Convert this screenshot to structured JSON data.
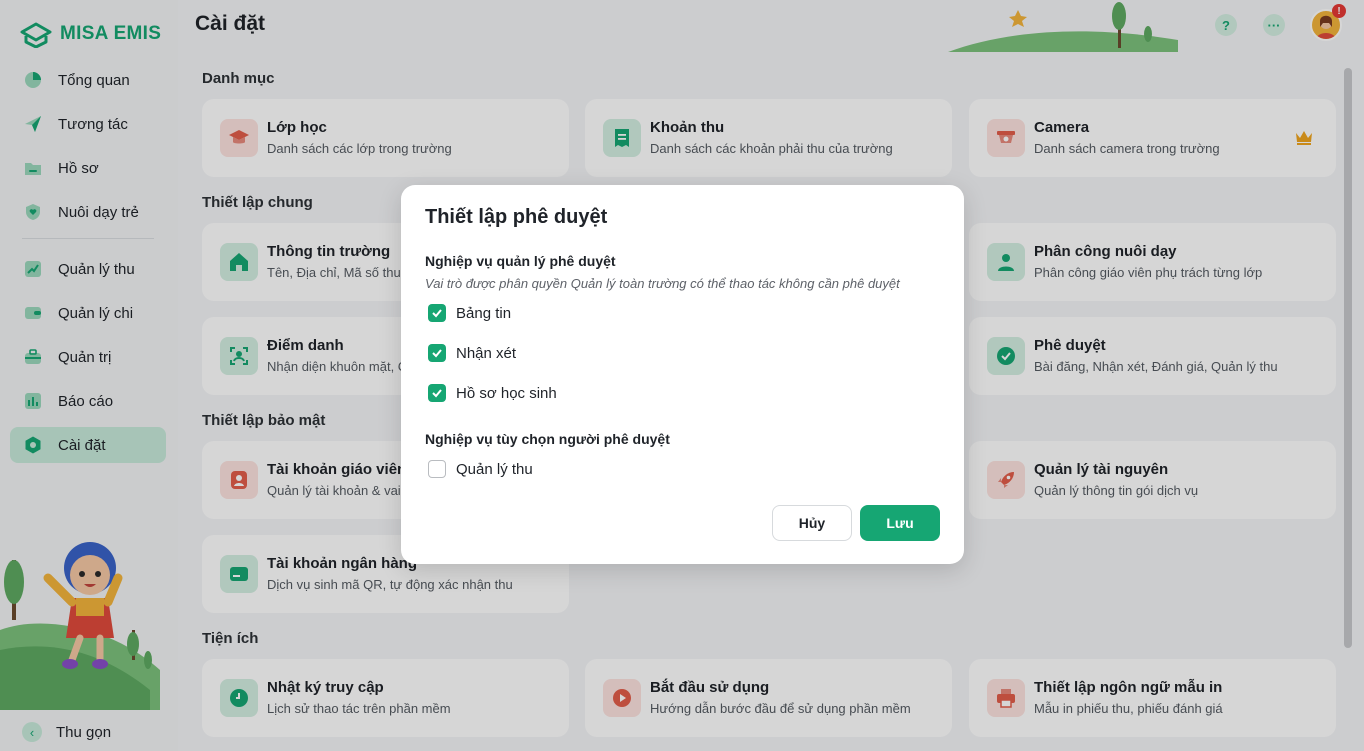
{
  "app": {
    "brand": "MISA EMIS",
    "page_title": "Cài đặt"
  },
  "sidebar": {
    "items": [
      {
        "label": "Tổng quan",
        "icon": "pie-chart-icon"
      },
      {
        "label": "Tương tác",
        "icon": "paper-plane-icon"
      },
      {
        "label": "Hồ sơ",
        "icon": "folder-icon"
      },
      {
        "label": "Nuôi dạy trẻ",
        "icon": "heart-shield-icon"
      },
      {
        "label": "Quản lý thu",
        "icon": "trend-chart-icon"
      },
      {
        "label": "Quản lý chi",
        "icon": "wallet-icon"
      },
      {
        "label": "Quản trị",
        "icon": "briefcase-icon"
      },
      {
        "label": "Báo cáo",
        "icon": "bar-chart-icon"
      },
      {
        "label": "Cài đặt",
        "icon": "gear-icon"
      }
    ],
    "active": "Cài đặt",
    "collapse_label": "Thu gọn"
  },
  "header": {
    "help": "?",
    "more": "···",
    "badge": "!"
  },
  "sections": {
    "danh_muc": "Danh mục",
    "chung": "Thiết lập chung",
    "bao_mat": "Thiết lập bảo mật",
    "tien_ich": "Tiện ích"
  },
  "cards": {
    "lop_hoc": {
      "title": "Lớp học",
      "desc": "Danh sách các lớp trong trường"
    },
    "khoan_thu": {
      "title": "Khoản thu",
      "desc": "Danh sách các khoản phải thu của trường"
    },
    "camera": {
      "title": "Camera",
      "desc": "Danh sách camera trong trường"
    },
    "thong_tin_truong": {
      "title": "Thông tin trường",
      "desc": "Tên, Địa chỉ, Mã số thuế"
    },
    "phan_cong": {
      "title": "Phân công nuôi dạy",
      "desc": "Phân công giáo viên phụ trách từng lớp"
    },
    "diem_danh": {
      "title": "Điểm danh",
      "desc": "Nhận diện khuôn mặt, C"
    },
    "phe_duyet": {
      "title": "Phê duyệt",
      "desc": "Bài đăng, Nhận xét, Đánh giá, Quản lý thu"
    },
    "tk_giao_vien": {
      "title": "Tài khoản giáo viên",
      "desc": "Quản lý tài khoản & vai t"
    },
    "quan_ly_tai_nguyen": {
      "title": "Quản lý tài nguyên",
      "desc": "Quản lý thông tin gói dịch vụ"
    },
    "tk_ngan_hang": {
      "title": "Tài khoản ngân hàng",
      "desc": "Dịch vụ sinh mã QR, tự động xác nhận thu"
    },
    "nhat_ky": {
      "title": "Nhật ký truy cập",
      "desc": "Lịch sử thao tác trên phần mềm"
    },
    "bat_dau": {
      "title": "Bắt đầu sử dụng",
      "desc": "Hướng dẫn bước đầu để sử dụng phần mềm"
    },
    "ngon_ngu": {
      "title": "Thiết lập ngôn ngữ mẫu in",
      "desc": "Mẫu in phiếu thu, phiếu đánh giá"
    }
  },
  "modal": {
    "title": "Thiết lập phê duyệt",
    "section1": "Nghiệp vụ quản lý phê duyệt",
    "note": "Vai trò được phân quyền Quản lý toàn trường có thể thao tác không cần phê duyệt",
    "options1": [
      {
        "label": "Bảng tin",
        "checked": true
      },
      {
        "label": "Nhận xét",
        "checked": true
      },
      {
        "label": "Hồ sơ học sinh",
        "checked": true
      }
    ],
    "section2": "Nghiệp vụ tùy chọn người phê duyệt",
    "options2": [
      {
        "label": "Quản lý thu",
        "checked": false
      }
    ],
    "cancel": "Hủy",
    "save": "Lưu"
  },
  "colors": {
    "accent": "#16a673",
    "active_bg": "#c8eadb"
  }
}
